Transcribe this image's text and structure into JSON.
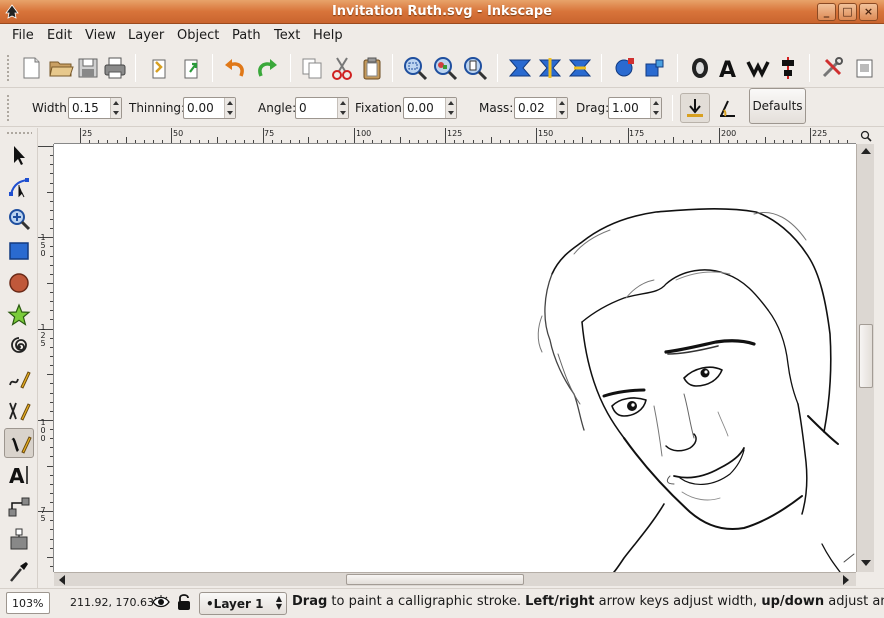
{
  "window": {
    "title": "Invitation Ruth.svg - Inkscape"
  },
  "menu": [
    "File",
    "Edit",
    "View",
    "Layer",
    "Object",
    "Path",
    "Text",
    "Help"
  ],
  "tool_controls": {
    "width_label": "Width:",
    "width_value": "0.15",
    "thinning_label": "Thinning:",
    "thinning_value": "0.00",
    "angle_label": "Angle:",
    "angle_value": "0",
    "fixation_label": "Fixation:",
    "fixation_value": "0.00",
    "mass_label": "Mass:",
    "mass_value": "0.02",
    "drag_label": "Drag:",
    "drag_value": "1.00",
    "defaults_label": "Defaults"
  },
  "ruler": {
    "top_ticks": [
      "25",
      "50",
      "75",
      "100",
      "125",
      "150",
      "175",
      "200",
      "225"
    ],
    "left_ticks": [
      "150",
      "125",
      "100",
      "75"
    ]
  },
  "status": {
    "zoom": "103%",
    "coords": "211.92, 170.63",
    "layer": "•Layer 1",
    "msg_b1": "Drag",
    "msg_t1": " to paint a calligraphic stroke. ",
    "msg_b2": "Left/right",
    "msg_t2": " arrow keys adjust width, ",
    "msg_b3": "up/down",
    "msg_t3": " adjust ang"
  },
  "colors": {
    "title_bar": "#d8743a",
    "accent_blue": "#1f5fbf",
    "canvas": "#ffffff"
  }
}
